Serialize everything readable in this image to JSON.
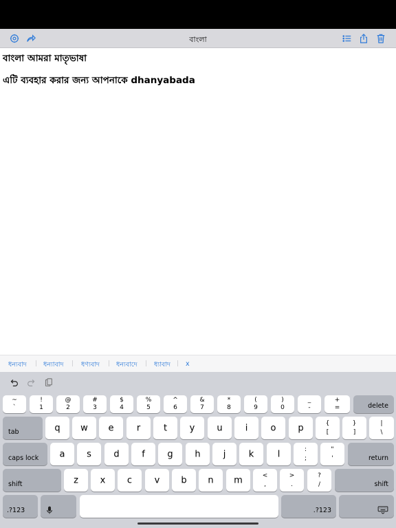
{
  "nav": {
    "title": "বাংলা",
    "left_icons": [
      "settings-icon",
      "share-arrow-icon"
    ],
    "right_icons": [
      "list-icon",
      "export-icon",
      "trash-icon"
    ]
  },
  "editor": {
    "lines": [
      "বাংলা আমরা মাতৃভাষা",
      "এটি ব্যবহার করার জন্য আপনাকে dhanyabada"
    ]
  },
  "suggestions": [
    "ধন্যবাদ",
    "ধন্যাবাদ",
    "ধণ্যবাদ",
    "ধন্যবাদে",
    "ধ্যাবাদ",
    "x"
  ],
  "keyboard": {
    "tools": [
      "undo-icon",
      "redo-icon",
      "paste-icon"
    ],
    "number_row": [
      {
        "top": "~",
        "bottom": "`"
      },
      {
        "top": "!",
        "bottom": "1"
      },
      {
        "top": "@",
        "bottom": "2"
      },
      {
        "top": "#",
        "bottom": "3"
      },
      {
        "top": "$",
        "bottom": "4"
      },
      {
        "top": "%",
        "bottom": "5"
      },
      {
        "top": "^",
        "bottom": "6"
      },
      {
        "top": "&",
        "bottom": "7"
      },
      {
        "top": "*",
        "bottom": "8"
      },
      {
        "top": "(",
        "bottom": "9"
      },
      {
        "top": ")",
        "bottom": "0"
      },
      {
        "top": "_",
        "bottom": "-"
      },
      {
        "top": "+",
        "bottom": "="
      }
    ],
    "delete_label": "delete",
    "tab_label": "tab",
    "row_q": [
      "q",
      "w",
      "e",
      "r",
      "t",
      "y",
      "u",
      "i",
      "o",
      "p"
    ],
    "row_q_symbols": [
      {
        "top": "{",
        "bottom": "["
      },
      {
        "top": "}",
        "bottom": "]"
      },
      {
        "top": "|",
        "bottom": "\\"
      }
    ],
    "caps_label": "caps lock",
    "row_a": [
      "a",
      "s",
      "d",
      "f",
      "g",
      "h",
      "j",
      "k",
      "l"
    ],
    "row_a_symbols": [
      {
        "top": ":",
        "bottom": ";"
      },
      {
        "top": "\"",
        "bottom": "'"
      }
    ],
    "return_label": "return",
    "shift_label": "shift",
    "row_z": [
      "z",
      "x",
      "c",
      "v",
      "b",
      "n",
      "m"
    ],
    "row_z_symbols": [
      {
        "top": "<",
        "bottom": ","
      },
      {
        "top": ">",
        "bottom": "."
      },
      {
        "top": "?",
        "bottom": "/"
      }
    ],
    "numbers_label": ".?123",
    "mic_icon": "microphone-icon",
    "space_label": "",
    "dismiss_icon": "keyboard-dismiss-icon"
  }
}
